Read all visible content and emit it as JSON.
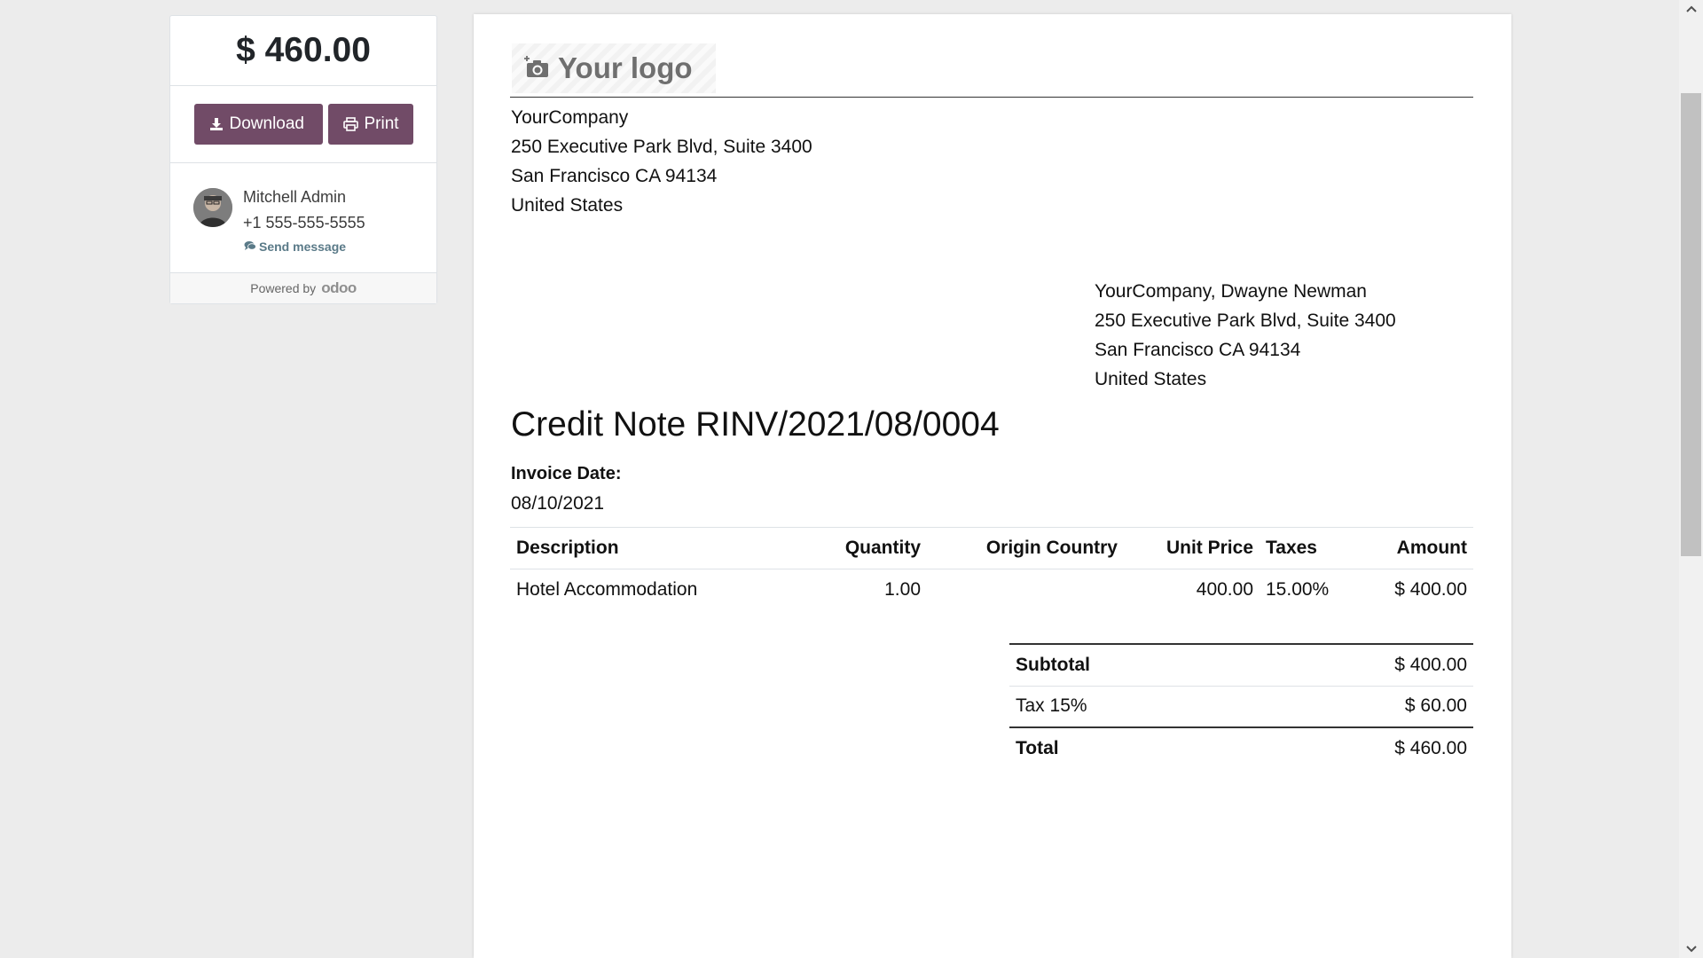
{
  "sidebar": {
    "amount": "$ 460.00",
    "download_label": "Download",
    "print_label": "Print",
    "contact": {
      "name": "Mitchell Admin",
      "phone": "+1 555-555-5555",
      "send_message_label": "Send message"
    },
    "powered_by_label": "Powered by",
    "powered_by_brand": "odoo"
  },
  "document": {
    "logo_text": "Your logo",
    "company_address": [
      "YourCompany",
      "250 Executive Park Blvd, Suite 3400",
      "San Francisco CA 94134",
      "United States"
    ],
    "partner_address": [
      "YourCompany, Dwayne Newman",
      "250 Executive Park Blvd, Suite 3400",
      "San Francisco CA 94134",
      "United States"
    ],
    "title": "Credit Note RINV/2021/08/0004",
    "invoice_date_label": "Invoice Date:",
    "invoice_date": "08/10/2021",
    "table": {
      "headers": {
        "description": "Description",
        "quantity": "Quantity",
        "origin_country": "Origin Country",
        "unit_price": "Unit Price",
        "taxes": "Taxes",
        "amount": "Amount"
      },
      "rows": [
        {
          "description": "Hotel Accommodation",
          "quantity": "1.00",
          "origin_country": "",
          "unit_price": "400.00",
          "taxes": "15.00%",
          "amount": "$ 400.00"
        }
      ]
    },
    "totals": {
      "subtotal_label": "Subtotal",
      "subtotal_value": "$ 400.00",
      "tax_label": "Tax 15%",
      "tax_value": "$ 60.00",
      "total_label": "Total",
      "total_value": "$ 460.00"
    }
  },
  "colors": {
    "primary_button": "#714b67",
    "page_background": "#ececec",
    "send_message_link": "#5a7a88"
  },
  "icons": {
    "download": "download-icon",
    "print": "printer-icon",
    "message": "comments-icon",
    "logo_placeholder": "camera-plus-icon"
  }
}
